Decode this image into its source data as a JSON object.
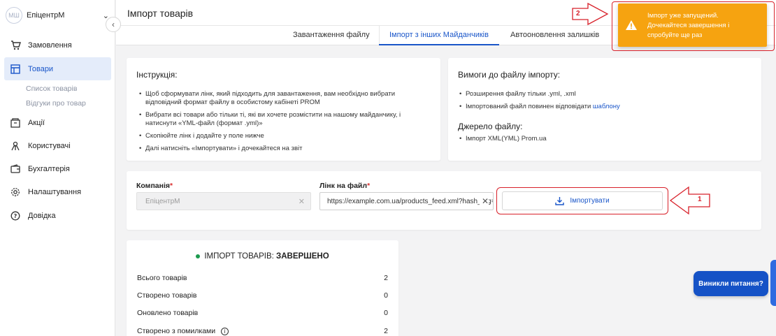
{
  "sidebar": {
    "avatar_initials": "МШ",
    "company": "ЕпіцентрМ",
    "items": [
      {
        "label": "Замовлення",
        "icon": "cart-icon"
      },
      {
        "label": "Товари",
        "icon": "products-icon",
        "active": true
      },
      {
        "label": "Акції",
        "icon": "promo-icon"
      },
      {
        "label": "Користувачі",
        "icon": "users-icon"
      },
      {
        "label": "Бухгалтерія",
        "icon": "wallet-icon"
      },
      {
        "label": "Налаштування",
        "icon": "gear-icon"
      },
      {
        "label": "Довідка",
        "icon": "help-icon"
      }
    ],
    "subitems": [
      "Список товарів",
      "Відгуки про товар"
    ]
  },
  "header": {
    "title": "Імпорт товарів"
  },
  "tabs": [
    {
      "label": "Завантаження файлу"
    },
    {
      "label": "Імпорт з інших Майданчиків",
      "active": true
    },
    {
      "label": "Автооновлення залишків"
    }
  ],
  "instructions": {
    "title": "Інструкція:",
    "items": [
      "Щоб сформувати лінк, який підходить для завантаження, вам необхідно вибрати відповідний формат файлу в особистому кабінеті PROM",
      "Вибрати всі товари або тільки ті, які ви хочете розмістити на нашому майданчику, і натиснути «YML-файл (формат .yml)»",
      "Скопіюйте лінк і додайте у поле нижче",
      "Далі натисніть «Імпортувати» і дочекайтеся на звіт"
    ]
  },
  "requirements": {
    "title": "Вимоги до файлу імпорту:",
    "items": [
      "Розширення файлу тільки .yml, .xml",
      "Імпортований файл повинен відповідати"
    ],
    "template_link": "шаблону",
    "source_title": "Джерело файлу:",
    "source_items": [
      "Імпорт XML(YML) Prom.ua"
    ]
  },
  "form": {
    "company_label": "Компанія",
    "company_value": "ЕпіцентрМ",
    "link_label": "Лінк на файл",
    "link_value": "https://example.com.ua/products_feed.xml?hash_tag=",
    "import_button": "Імпортувати",
    "required_mark": "*"
  },
  "status": {
    "title_prefix": "ІМПОРТ ТОВАРІВ:",
    "title_status": "ЗАВЕРШЕНО",
    "status_color": "#1c9a4e",
    "rows": [
      {
        "label": "Всього товарів",
        "value": "2"
      },
      {
        "label": "Створено товарів",
        "value": "0"
      },
      {
        "label": "Оновлено товарів",
        "value": "0"
      },
      {
        "label": "Створено з помилками",
        "value": "2"
      }
    ]
  },
  "toast": {
    "message": "Імпорт уже запущений. Дочекайтеся завершення і спробуйте ще раз",
    "color": "#f6a310"
  },
  "help_button": "Виникли питання?",
  "callouts": [
    "1",
    "2"
  ],
  "colors": {
    "accent": "#1a56c9",
    "annotation": "#d8212a"
  }
}
